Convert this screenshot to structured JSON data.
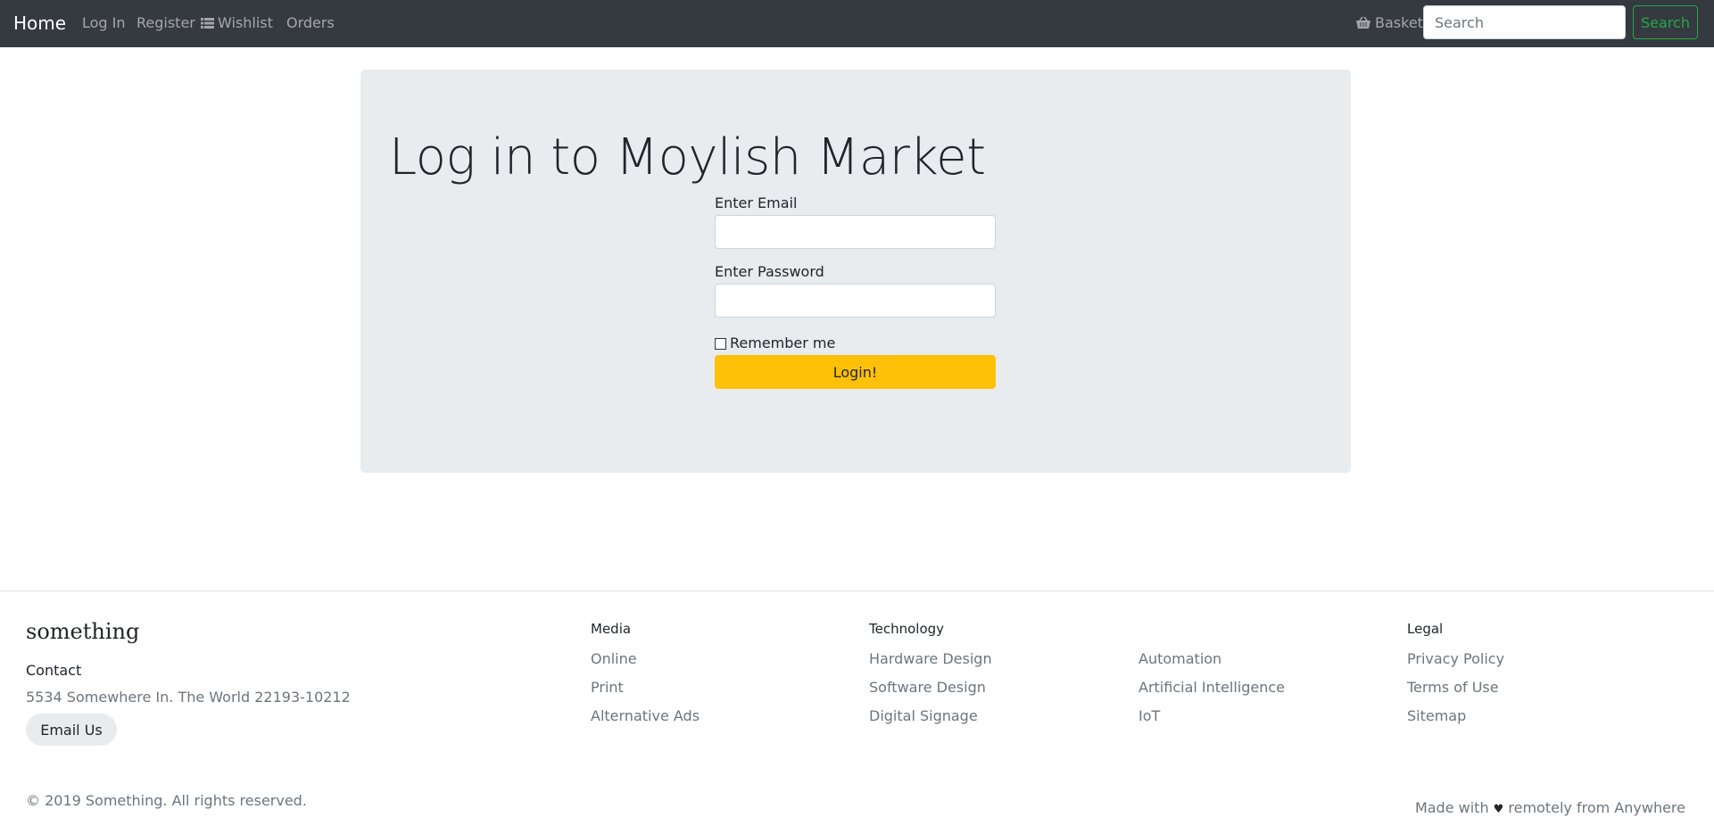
{
  "navbar": {
    "brand": "Home",
    "links": [
      {
        "label": "Log In"
      },
      {
        "label": "Register"
      },
      {
        "label": "Wishlist",
        "icon": "list-icon"
      },
      {
        "label": "Orders"
      }
    ],
    "basket": {
      "label": "Basket",
      "icon": "basket-icon"
    },
    "search": {
      "placeholder": "Search",
      "value": "",
      "button_label": "Search"
    }
  },
  "login": {
    "title": "Log in to Moylish Market",
    "email_label": "Enter Email",
    "email_value": "",
    "password_label": "Enter Password",
    "password_value": "",
    "remember_label": "Remember me",
    "remember_checked": false,
    "submit_label": "Login!",
    "submit_color": "#ffc107"
  },
  "footer": {
    "brand": "something",
    "contact_heading": "Contact",
    "address": "5534 Somewhere In. The World 22193-10212",
    "email_button": "Email Us",
    "columns": [
      {
        "heading": "Media",
        "links": [
          "Online",
          "Print",
          "Alternative Ads"
        ]
      },
      {
        "heading": "Technology",
        "links": [
          "Hardware Design",
          "Software Design",
          "Digital Signage"
        ]
      },
      {
        "heading": "",
        "links": [
          "Automation",
          "Artificial Intelligence",
          "IoT"
        ]
      },
      {
        "heading": "Legal",
        "links": [
          "Privacy Policy",
          "Terms of Use",
          "Sitemap"
        ]
      }
    ],
    "copyright": "© 2019 Something. All rights reserved.",
    "made_with_prefix": "Made with",
    "heart": "♥",
    "made_with_suffix": "remotely from Anywhere"
  },
  "colors": {
    "navbar_bg": "#343a40",
    "jumbotron_bg": "#e9ecef",
    "search_accent": "#28a745",
    "login_button": "#ffc107"
  }
}
